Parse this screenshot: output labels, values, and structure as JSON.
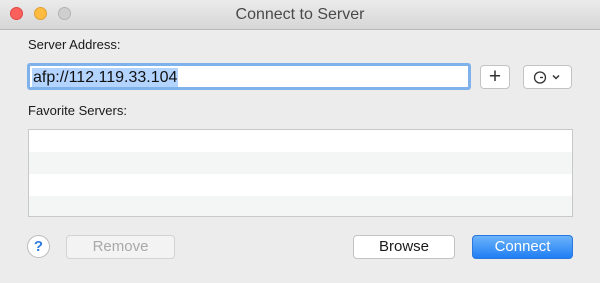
{
  "window": {
    "title": "Connect to Server"
  },
  "server_address": {
    "label": "Server Address:",
    "value": "afp://112.119.33.104"
  },
  "toolbar": {
    "add_favorite_icon": "plus-icon",
    "add_favorite_symbol": "+",
    "recent_servers_icon": "clock-icon"
  },
  "favorites": {
    "label": "Favorite Servers:",
    "items": []
  },
  "buttons": {
    "help": "?",
    "remove": "Remove",
    "browse": "Browse",
    "connect": "Connect"
  },
  "colors": {
    "accent": "#1f7ef4",
    "focus_ring": "#7fb1ea",
    "selection": "#b3d4fe",
    "close": "#fc605c",
    "minimize": "#fdbc40",
    "zoom_disabled": "#cfcfcf"
  }
}
